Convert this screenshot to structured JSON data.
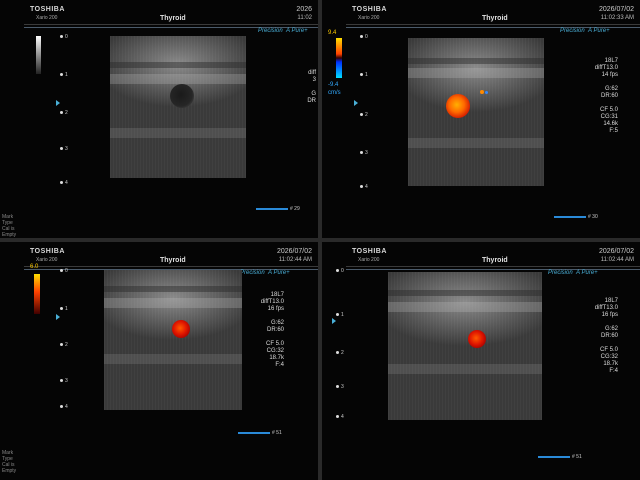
{
  "panels": [
    {
      "brand": "TOSHIBA",
      "model": "Xario 200",
      "preset": "Thyroid",
      "date": "2026",
      "time": "11:02",
      "precision": "Precision",
      "apure": "A Pure+",
      "params": [
        "diff",
        "3",
        "",
        "G",
        "DR"
      ],
      "frame": "# 29",
      "marks": [
        "Mark",
        "Type",
        "Cal is Empty"
      ],
      "depths": [
        "0",
        "1",
        "2",
        "3",
        "4"
      ]
    },
    {
      "brand": "TOSHIBA",
      "model": "Xario 200",
      "preset": "Thyroid",
      "date": "2026/07/02",
      "time": "11:02:33 AM",
      "precision": "Precision",
      "apure": "A Pure+",
      "scale_top": "9.4",
      "scale_bottom": "-9.4",
      "scale_unit": "cm/s",
      "params": [
        "18L7",
        "diffT13.0",
        "14 fps",
        "",
        "G:62",
        "DR:60",
        "",
        "CF 5.0",
        "CG:31",
        "14.6k",
        "F:5"
      ],
      "frame": "# 30",
      "depths": [
        "0",
        "1",
        "2",
        "3",
        "4"
      ]
    },
    {
      "brand": "TOSHIBA",
      "model": "Xario 200",
      "preset": "Thyroid",
      "date": "2026/07/02",
      "time": "11:02:44 AM",
      "precision": "Precision",
      "apure": "A Pure+",
      "scale_top": "6.0",
      "params": [
        "18L7",
        "diffT13.0",
        "16 fps",
        "",
        "G:62",
        "DR:60",
        "",
        "CF 5.0",
        "CG:32",
        "18.7k",
        "F:4"
      ],
      "frame": "# 51",
      "marks": [
        "Mark",
        "Type",
        "Cal is Empty"
      ],
      "depths": [
        "0",
        "1",
        "2",
        "3",
        "4"
      ]
    },
    {
      "brand": "TOSHIBA",
      "model": "Xario 200",
      "preset": "Thyroid",
      "date": "2026/07/02",
      "time": "11:02:44 AM",
      "precision": "Precision",
      "apure": "A Pure+",
      "params": [
        "18L7",
        "diffT13.0",
        "16 fps",
        "",
        "G:62",
        "DR:60",
        "",
        "CF 5.0",
        "CG:32",
        "18.7k",
        "F:4"
      ],
      "frame": "# 51",
      "depths": [
        "0",
        "1",
        "2",
        "3",
        "4"
      ]
    }
  ],
  "colors": {
    "accent": "#4ab0d8",
    "flow_hot": "#ff6a00",
    "flow_red": "#e01600"
  }
}
